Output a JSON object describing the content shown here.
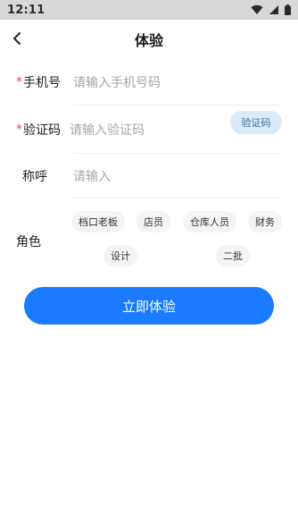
{
  "status_bar": {
    "time": "12:11",
    "icons": [
      "wifi-icon",
      "cell-signal-icon",
      "battery-icon"
    ]
  },
  "header": {
    "title": "体验",
    "back_icon": "chevron-left-icon"
  },
  "form": {
    "phone": {
      "label": "手机号",
      "required_mark": "*",
      "placeholder": "请输入手机号码"
    },
    "code": {
      "label": "验证码",
      "required_mark": "*",
      "placeholder": "请输入验证码",
      "button_label": "验证码"
    },
    "name": {
      "label": "称呼",
      "placeholder": "请输入"
    },
    "role": {
      "label": "角色",
      "options": [
        "档口老板",
        "店员",
        "仓库人员",
        "财务",
        "设计",
        "二批"
      ]
    }
  },
  "submit_label": "立即体验",
  "colors": {
    "primary": "#1a7bff",
    "required": "#e34a4a",
    "code_button_bg": "#dbeaf7",
    "chip_bg": "#f4f4f4",
    "status_bar_bg": "#d8d8d8"
  }
}
